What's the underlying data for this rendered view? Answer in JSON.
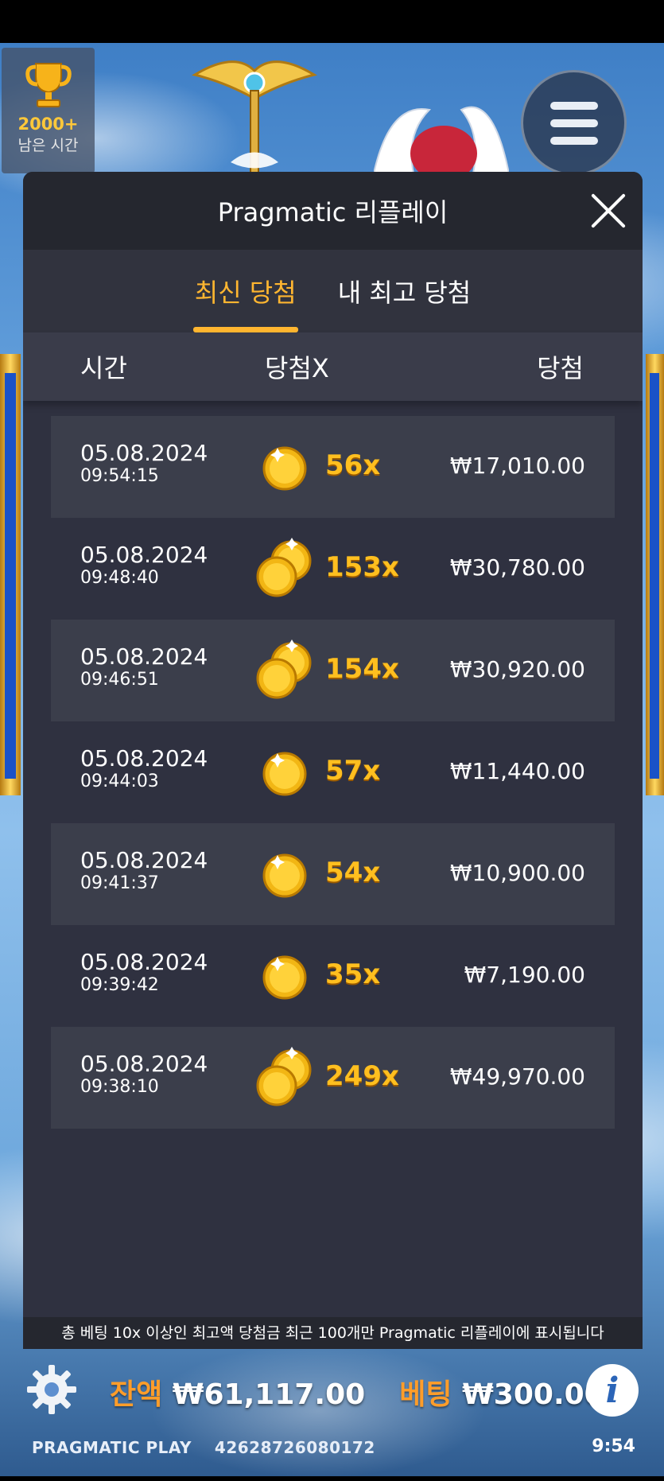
{
  "tournament": {
    "count": "2000+",
    "label": "남은 시간"
  },
  "modal": {
    "title": "Pragmatic 리플레이",
    "tabs": [
      {
        "label": "최신 당첨",
        "active": true
      },
      {
        "label": "내 최고 당첨",
        "active": false
      }
    ],
    "columns": {
      "time": "시간",
      "multiplier": "당첨X",
      "win": "당첨"
    },
    "rows": [
      {
        "date": "05.08.2024",
        "time": "09:54:15",
        "multiplier": "56x",
        "win": "₩17,010.00",
        "coins": 1
      },
      {
        "date": "05.08.2024",
        "time": "09:48:40",
        "multiplier": "153x",
        "win": "₩30,780.00",
        "coins": 2
      },
      {
        "date": "05.08.2024",
        "time": "09:46:51",
        "multiplier": "154x",
        "win": "₩30,920.00",
        "coins": 2
      },
      {
        "date": "05.08.2024",
        "time": "09:44:03",
        "multiplier": "57x",
        "win": "₩11,440.00",
        "coins": 1
      },
      {
        "date": "05.08.2024",
        "time": "09:41:37",
        "multiplier": "54x",
        "win": "₩10,900.00",
        "coins": 1
      },
      {
        "date": "05.08.2024",
        "time": "09:39:42",
        "multiplier": "35x",
        "win": "₩7,190.00",
        "coins": 1
      },
      {
        "date": "05.08.2024",
        "time": "09:38:10",
        "multiplier": "249x",
        "win": "₩49,970.00",
        "coins": 2
      }
    ],
    "footer_note": "총 베팅 10x 이상인 최고액 당첨금 최근 100개만 Pragmatic 리플레이에 표시됩니다"
  },
  "status": {
    "balance_label": "잔액",
    "balance_value": "₩61,117.00",
    "bet_label": "베팅",
    "bet_value": "₩300.00"
  },
  "brand": {
    "name": "PRAGMATIC PLAY",
    "id": "42628726080172"
  },
  "clock": "9:54",
  "colors": {
    "accent": "#ffb630",
    "modal_bg": "#2f3140",
    "row_shade": "#3b3e4b"
  }
}
